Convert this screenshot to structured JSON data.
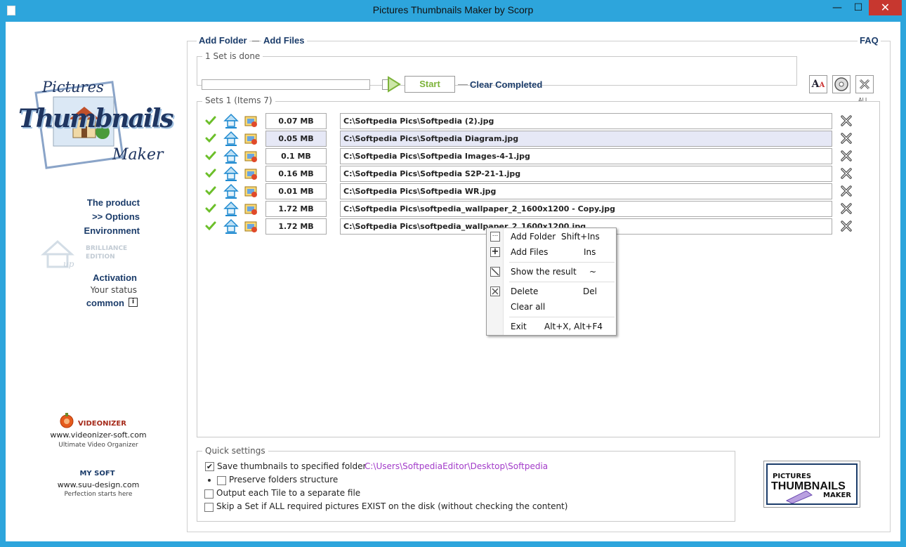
{
  "window": {
    "title": "Pictures Thumbnails Maker by Scorp",
    "min_glyph": "—",
    "max_glyph": "☐",
    "close_glyph": "✕"
  },
  "logo": {
    "line1": "Pictures",
    "line2": "Thumbnails",
    "line3": "Maker"
  },
  "sidebar": {
    "product": "The product",
    "options": ">> Options",
    "environment": "Environment",
    "brilliance": "BRILLIANCE",
    "edition": "EDITION",
    "activation": "Activation",
    "your_status": "Your status",
    "common": "common",
    "videonizer": {
      "name": "VIDEONIZER",
      "url": "www.videonizer-soft.com",
      "tagline": "Ultimate Video Organizer"
    },
    "mysoft": {
      "name": "MY SOFT",
      "url": "www.suu-design.com",
      "tagline": "Perfection starts here"
    }
  },
  "toolbar": {
    "add_folder": "Add Folder",
    "dash": "—",
    "add_files": "Add Files",
    "faq": "FAQ",
    "status_label": "1 Set is done",
    "start": "Start",
    "clear_completed": "Clear Completed",
    "all_label": "ALL"
  },
  "sets": {
    "label": "Sets 1 (Items 7)",
    "rows": [
      {
        "size": "0.07 MB",
        "path": "C:\\Softpedia Pics\\Softpedia (2).jpg"
      },
      {
        "size": "0.05 MB",
        "path": "C:\\Softpedia Pics\\Softpedia Diagram.jpg"
      },
      {
        "size": "0.1 MB",
        "path": "C:\\Softpedia Pics\\Softpedia Images-4-1.jpg"
      },
      {
        "size": "0.16 MB",
        "path": "C:\\Softpedia Pics\\Softpedia S2P-21-1.jpg"
      },
      {
        "size": "0.01 MB",
        "path": "C:\\Softpedia Pics\\Softpedia WR.jpg"
      },
      {
        "size": "1.72 MB",
        "path": "C:\\Softpedia Pics\\softpedia_wallpaper_2_1600x1200 - Copy.jpg"
      },
      {
        "size": "1.72 MB",
        "path": "C:\\Softpedia Pics\\softpedia_wallpaper_2_1600x1200.jpg"
      }
    ]
  },
  "context_menu": {
    "add_folder": "Add Folder",
    "add_folder_key": "Shift+Ins",
    "add_files": "Add Files",
    "add_files_key": "Ins",
    "show_result": "Show the result",
    "show_result_key": "~",
    "delete": "Delete",
    "delete_key": "Del",
    "clear_all": "Clear all",
    "exit": "Exit",
    "exit_key": "Alt+X, Alt+F4"
  },
  "quick_settings": {
    "label": "Quick settings",
    "save_thumbs": "Save thumbnails to specified folder",
    "save_path": "C:\\Users\\SoftpediaEditor\\Desktop\\Softpedia",
    "preserve": "Preserve folders structure",
    "output_tile": "Output each Tile to a separate file",
    "skip_set": "Skip a Set if ALL required pictures EXIST on the disk (without checking the content)"
  },
  "badge": {
    "line1": "PICTURES",
    "line2": "THUMBNAILS",
    "line3": "MAKER"
  },
  "colors": {
    "title_bar": "#2da5dc",
    "link_navy": "#1b3c6a",
    "start_green": "#7db33a",
    "path_purple": "#a23bc9",
    "selected_row": "#e6e8f6",
    "close_red": "#c7372f"
  }
}
